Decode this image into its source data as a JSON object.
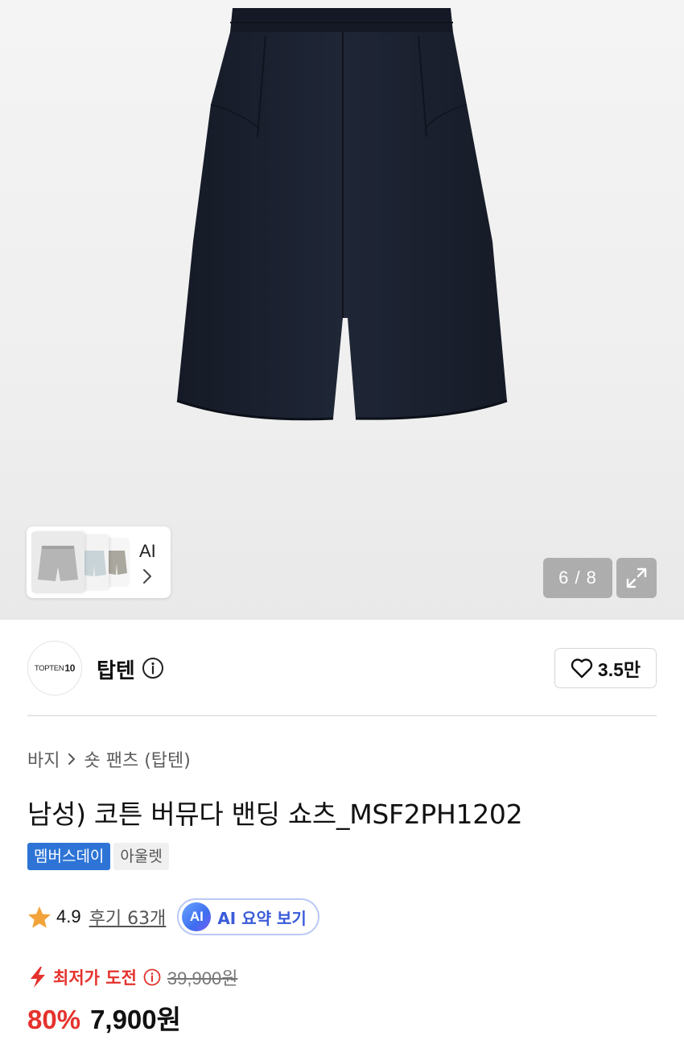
{
  "gallery": {
    "ai_thumb_label": "AI",
    "counter": "6 / 8",
    "current_index": 6,
    "total": 8
  },
  "brand": {
    "logo_text": "TOPTEN",
    "logo_mark": "10",
    "name": "탑텐",
    "like_count": "3.5만"
  },
  "breadcrumb": {
    "items": [
      "바지",
      "숏 팬츠 (탑텐)"
    ]
  },
  "product": {
    "title": "남성) 코튼 버뮤다 밴딩 쇼츠_MSF2PH1202",
    "badges": [
      "멤버스데이",
      "아울렛"
    ]
  },
  "rating": {
    "score": "4.9",
    "reviews_label": "후기 63개",
    "ai_icon": "AI",
    "ai_summary_label": "AI 요약 보기"
  },
  "price": {
    "challenge_label": "최저가 도전",
    "original": "39,900원",
    "discount": "80%",
    "sale": "7,900원"
  },
  "colors": {
    "accent_red": "#e5322d",
    "badge_blue": "#2d74d6",
    "ai_blue": "#3a5bd9",
    "star": "#f2a33a",
    "shorts_navy": "#1c2230"
  },
  "icons": [
    "chevron-right-icon",
    "expand-icon",
    "info-icon",
    "heart-icon",
    "star-icon",
    "lightning-icon"
  ]
}
